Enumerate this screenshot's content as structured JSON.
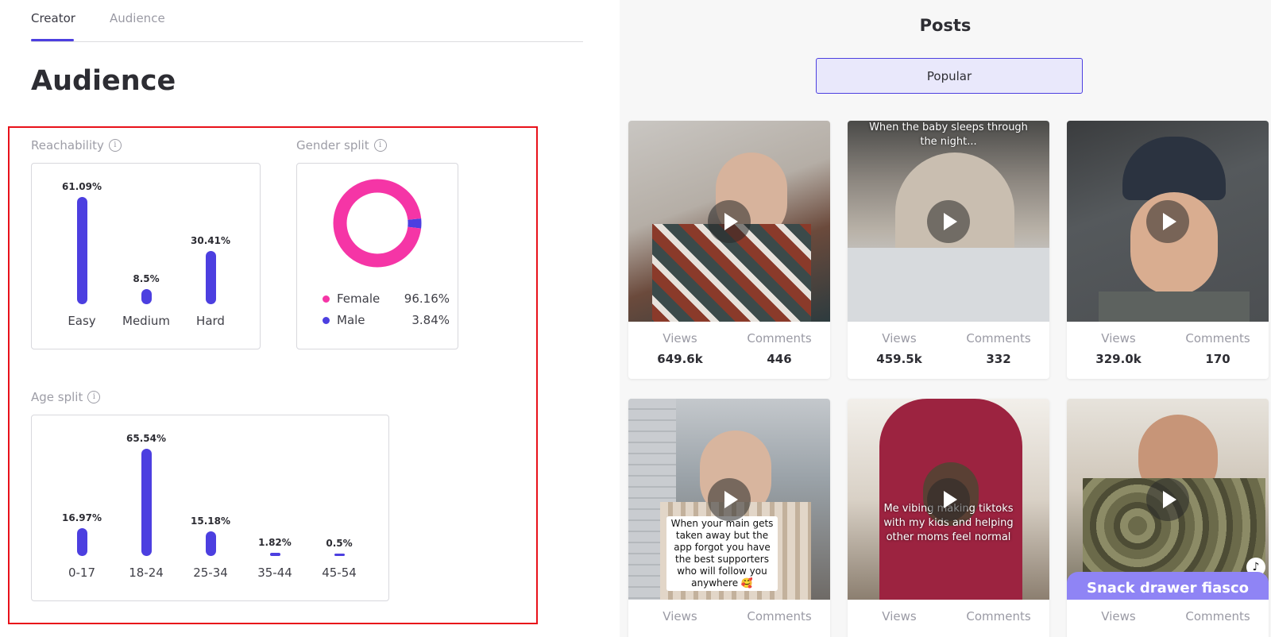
{
  "tabs": [
    {
      "label": "Creator",
      "active": true
    },
    {
      "label": "Audience",
      "active": false
    }
  ],
  "page_title": "Audience",
  "reachability": {
    "label": "Reachability",
    "bars": [
      {
        "category": "Easy",
        "value": 61.09,
        "label": "61.09%"
      },
      {
        "category": "Medium",
        "value": 8.5,
        "label": "8.5%"
      },
      {
        "category": "Hard",
        "value": 30.41,
        "label": "30.41%"
      }
    ]
  },
  "gender": {
    "label": "Gender split",
    "items": [
      {
        "name": "Female",
        "value": 96.16,
        "label": "96.16%",
        "color": "#f535a6"
      },
      {
        "name": "Male",
        "value": 3.84,
        "label": "3.84%",
        "color": "#4c3fe0"
      }
    ]
  },
  "age": {
    "label": "Age split",
    "bars": [
      {
        "category": "0-17",
        "value": 16.97,
        "label": "16.97%"
      },
      {
        "category": "18-24",
        "value": 65.54,
        "label": "65.54%"
      },
      {
        "category": "25-34",
        "value": 15.18,
        "label": "15.18%"
      },
      {
        "category": "35-44",
        "value": 1.82,
        "label": "1.82%"
      },
      {
        "category": "45-54",
        "value": 0.5,
        "label": "0.5%"
      }
    ]
  },
  "chart_data": [
    {
      "type": "bar",
      "title": "",
      "categories": [
        "Easy",
        "Medium",
        "Hard"
      ],
      "values": [
        61.09,
        8.5,
        30.41
      ]
    },
    {
      "type": "pie",
      "title": "",
      "categories": [
        "Female",
        "Male"
      ],
      "values": [
        96.16,
        3.84
      ]
    },
    {
      "type": "bar",
      "title": "",
      "categories": [
        "0-17",
        "18-24",
        "25-34",
        "35-44",
        "45-54"
      ],
      "values": [
        16.97,
        65.54,
        15.18,
        1.82,
        0.5
      ]
    }
  ],
  "posts": {
    "title": "Posts",
    "filter_label": "Popular",
    "views_label": "Views",
    "comments_label": "Comments",
    "items": [
      {
        "views": "649.6k",
        "comments": "446",
        "caption": ""
      },
      {
        "views": "459.5k",
        "comments": "332",
        "caption": "When the baby sleeps through the night..."
      },
      {
        "views": "329.0k",
        "comments": "170",
        "caption": ""
      },
      {
        "views": "",
        "comments": "",
        "caption": "When your main gets taken away but the app forgot you have the best supporters who will follow you anywhere 🥰"
      },
      {
        "views": "",
        "comments": "",
        "caption": "Me vibing making tiktoks with my kids and helping other moms feel normal"
      },
      {
        "views": "",
        "comments": "",
        "caption": "Snack drawer fiasco"
      }
    ]
  },
  "colors": {
    "accent": "#4c3fe0",
    "female": "#f535a6",
    "highlight": "#e8111a"
  }
}
